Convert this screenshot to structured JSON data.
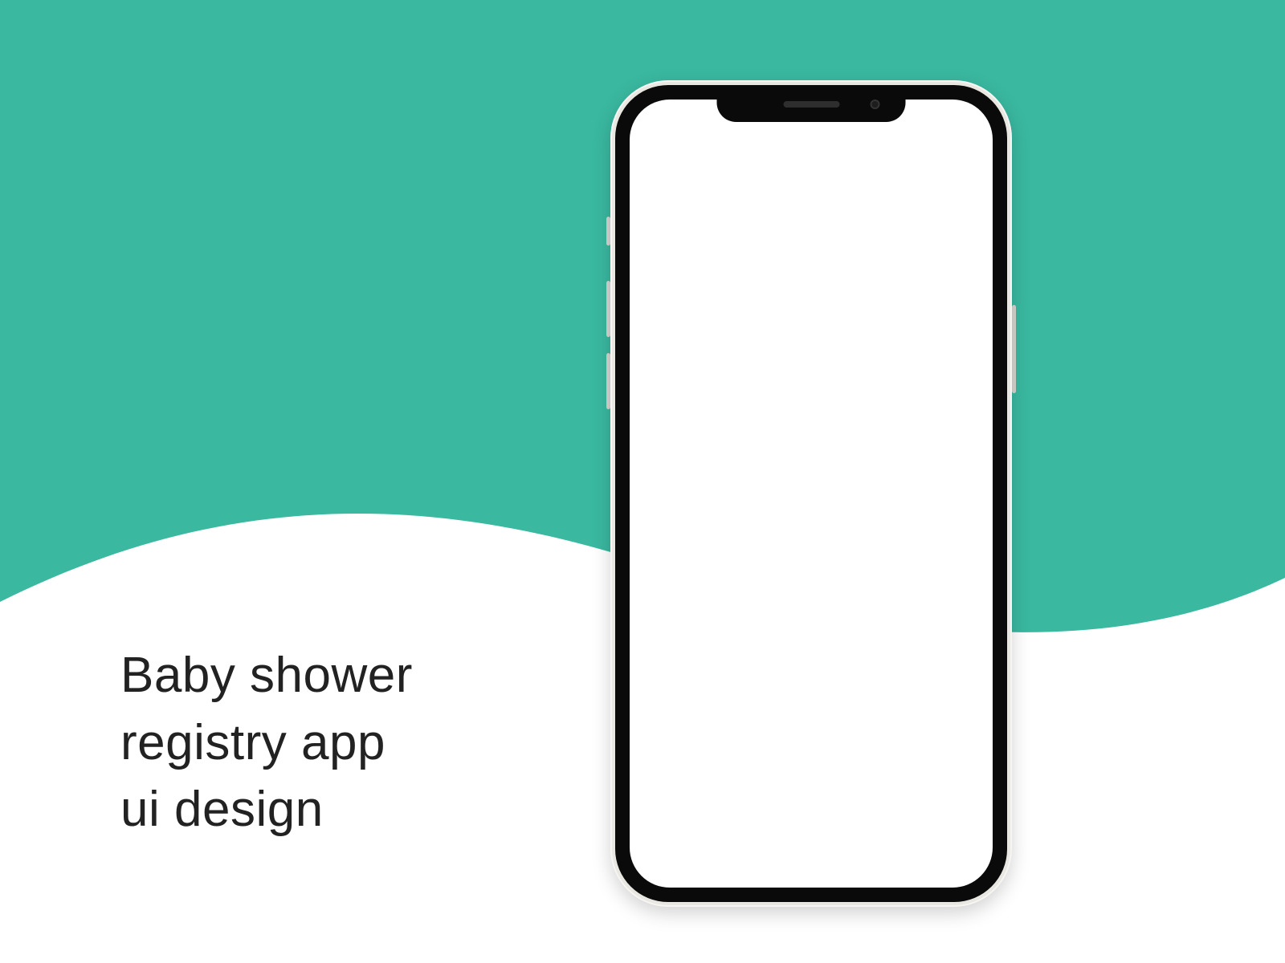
{
  "colors": {
    "teal": "#3ab8a0",
    "text": "#222222",
    "phone_frame": "#e9e7e2",
    "phone_bezel": "#0a0a0a",
    "phone_screen": "#ffffff"
  },
  "title": {
    "line1": "Baby shower",
    "line2": "registry app",
    "line3": "ui design"
  },
  "phone": {
    "screen_content": ""
  }
}
